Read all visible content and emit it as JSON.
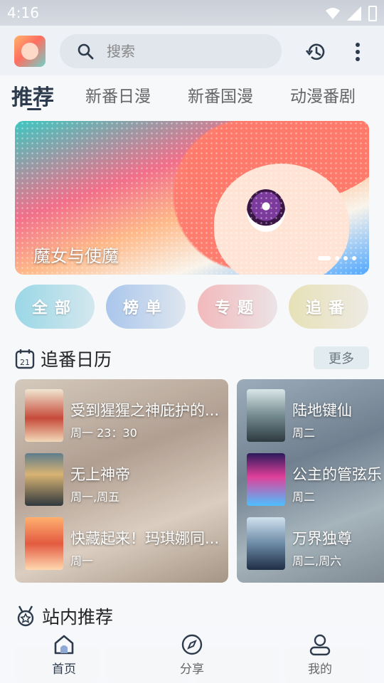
{
  "status_bar": {
    "time": "4:16"
  },
  "search": {
    "placeholder": "搜索"
  },
  "tabs": [
    {
      "label": "推荐",
      "active": true
    },
    {
      "label": "新番日漫"
    },
    {
      "label": "新番国漫"
    },
    {
      "label": "动漫番剧"
    }
  ],
  "banner": {
    "title": "魔女与使魔"
  },
  "quick_buttons": [
    {
      "label": "全部"
    },
    {
      "label": "榜单"
    },
    {
      "label": "专题"
    },
    {
      "label": "追番"
    }
  ],
  "calendar": {
    "title": "追番日历",
    "more_label": "更多",
    "cards": [
      {
        "items": [
          {
            "name": "受到猩猩之神庇护的...",
            "when": "周一 23：30"
          },
          {
            "name": "无上神帝",
            "when": "周一,周五"
          },
          {
            "name": "快藏起来！玛琪娜同...",
            "when": "周一"
          }
        ]
      },
      {
        "items": [
          {
            "name": "陆地键仙",
            "when": "周二"
          },
          {
            "name": "公主的管弦乐",
            "when": "周二"
          },
          {
            "name": "万界独尊",
            "when": "周二,周六"
          }
        ]
      }
    ]
  },
  "recommend": {
    "title": "站内推荐"
  },
  "nav": [
    {
      "label": "首页",
      "active": true
    },
    {
      "label": "分享"
    },
    {
      "label": "我的"
    }
  ]
}
